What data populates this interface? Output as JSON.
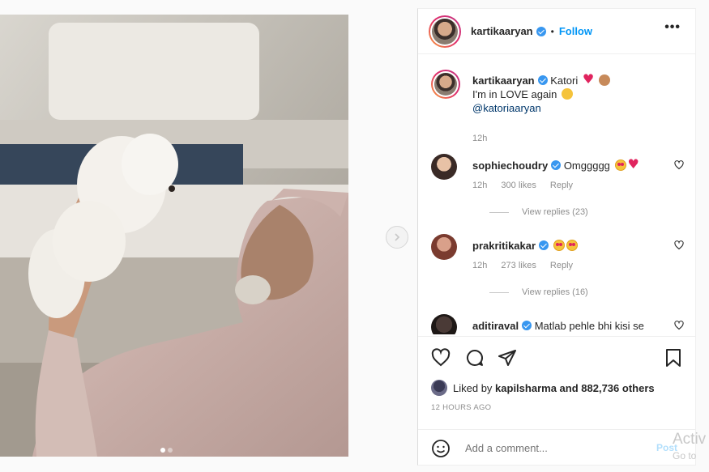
{
  "post": {
    "username": "kartikaaryan",
    "follow_label": "Follow",
    "separator": "•",
    "more_label": "•••",
    "caption_line1": "Katori",
    "caption_line2": "I'm in LOVE again",
    "caption_mention": "@katoriaaryan",
    "caption_time": "12h",
    "likes_prefix": "Liked by",
    "likes_user": "kapilsharma",
    "likes_suffix": "and 882,736 others",
    "timestamp": "12 HOURS AGO",
    "add_comment_placeholder": "Add a comment...",
    "post_label": "Post"
  },
  "comments": [
    {
      "username": "sophiechoudry",
      "text": "Omggggg",
      "time": "12h",
      "likes": "300 likes",
      "reply": "Reply",
      "view_replies": "View replies (23)"
    },
    {
      "username": "prakritikakar",
      "text": "",
      "time": "12h",
      "likes": "273 likes",
      "reply": "Reply",
      "view_replies": "View replies (16)"
    },
    {
      "username": "aditiraval",
      "text": "Matlab pehle bhi kisi se"
    }
  ],
  "watermark": {
    "line1": "Activ",
    "line2": "Go to"
  },
  "colors": {
    "link": "#0095f6",
    "verified": "#3897f0",
    "muted": "#8e8e8e",
    "heart": "#e0245e"
  },
  "icons": [
    "heart-icon",
    "comment-icon",
    "share-icon",
    "bookmark-icon",
    "emoji-icon",
    "chevron-right-icon",
    "verified-badge-icon",
    "more-options-icon"
  ]
}
